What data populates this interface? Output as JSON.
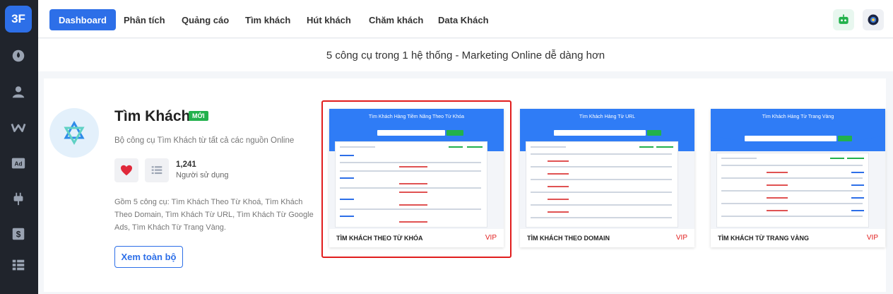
{
  "logo": "3F",
  "nav": {
    "items": [
      "Dashboard",
      "Phân tích",
      "Quảng cáo",
      "Tìm khách",
      "Hút khách",
      "Chăm khách",
      "Data Khách"
    ]
  },
  "banner": "5 công cụ trong 1 hệ thống - Marketing Online dễ dàng hơn",
  "tool": {
    "title": "Tìm Khách",
    "badge": "MỚI",
    "subtitle": "Bộ công cụ Tìm Khách từ tất cả các nguồn Online",
    "count": "1,241",
    "count_label": "Người sử dụng",
    "description": "Gồm 5 công cụ: Tìm Khách Theo Từ Khoá, Tìm Khách Theo Domain, Tìm Khách Từ URL, Tìm Khách Từ Google Ads, Tìm Khách Từ Trang Vàng.",
    "view_all": "Xem toàn bộ"
  },
  "previews": [
    {
      "shot_title": "Tìm Khách Hàng Tiềm Năng Theo Từ Khóa",
      "name": "TÌM KHÁCH THEO TỪ KHÓA",
      "tag": "VIP"
    },
    {
      "shot_title": "Tìm Khách Hàng Từ URL",
      "name": "TÌM KHÁCH THEO DOMAIN",
      "tag": "VIP"
    },
    {
      "shot_title": "Tìm Khách Hàng Từ Trang Vàng",
      "name": "TÌM KHÁCH TỪ TRANG VÀNG",
      "tag": "VIP"
    }
  ],
  "icons": {
    "sidebar": [
      "dashboard-icon",
      "user-icon",
      "w-brand-icon",
      "ad-icon",
      "plug-icon",
      "dollar-icon",
      "list-icon"
    ],
    "top_right": [
      "robot-icon",
      "globe-icon"
    ]
  },
  "colors": {
    "accent": "#2d6fe8",
    "sidebar": "#20242c",
    "badge": "#22b14c",
    "vip": "#e11d1d",
    "highlight": "#e11d1d"
  }
}
